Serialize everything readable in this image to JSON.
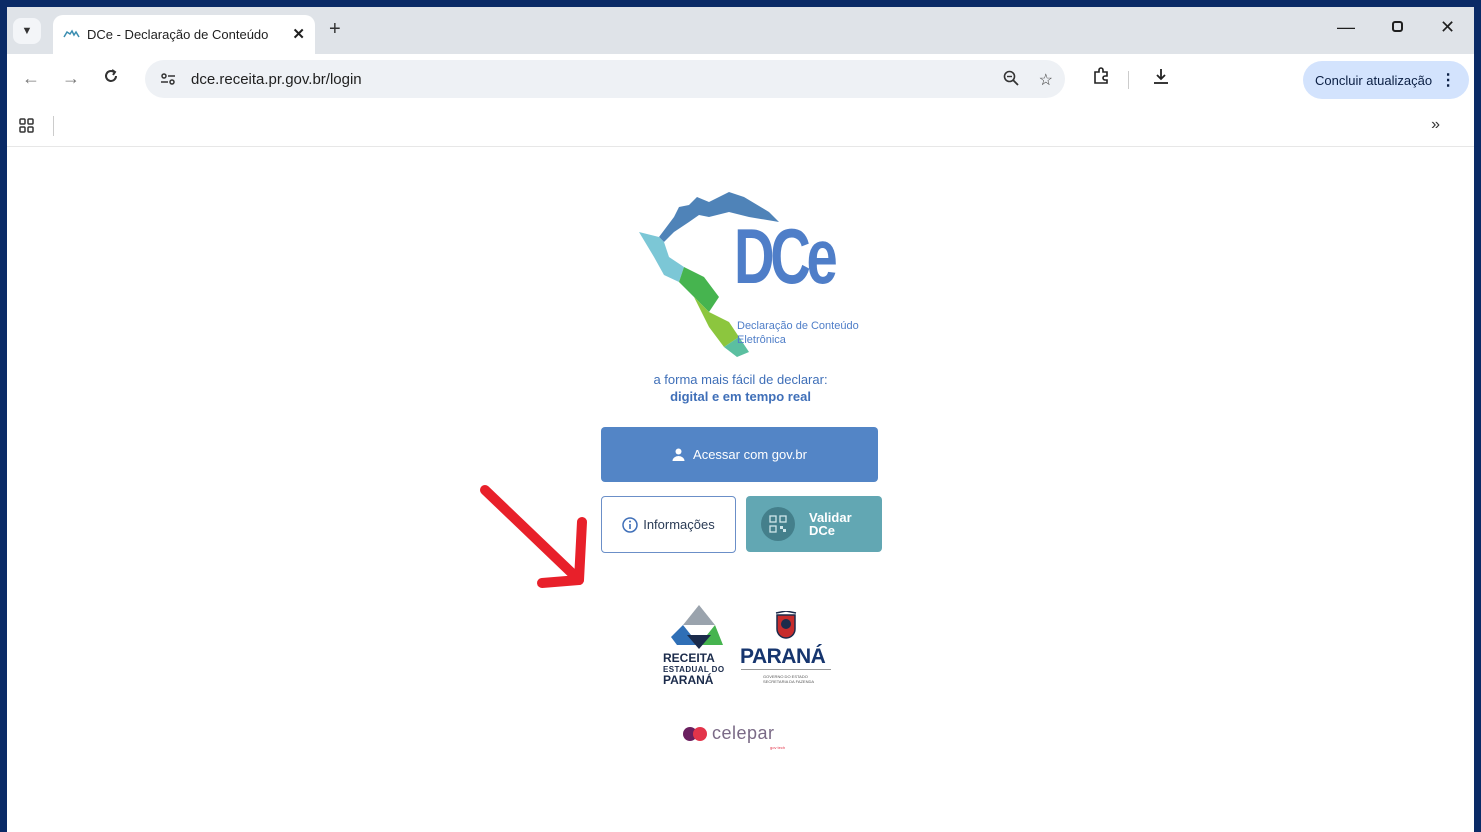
{
  "browser": {
    "tab": {
      "title": "DCe - Declaração de Conteúdo"
    },
    "url": "dce.receita.pr.gov.br/login",
    "update_button": "Concluir atualização"
  },
  "page": {
    "logo": {
      "name": "DCe",
      "subtitle_line1": "Declaração de Conteúdo",
      "subtitle_line2": "Eletrônica"
    },
    "tagline_line1": "a forma mais fácil de declarar:",
    "tagline_line2": "digital e em tempo real",
    "login_button": "Acessar com gov.br",
    "info_button": "Informações",
    "validar_line1": "Validar",
    "validar_line2": "DCe",
    "footer": {
      "receita_line1": "RECEITA",
      "receita_line2": "ESTADUAL DO",
      "receita_line3": "PARANÁ",
      "parana": "PARANÁ",
      "parana_sub1": "GOVERNO DO ESTADO",
      "parana_sub2": "SECRETARIA DA FAZENDA",
      "celepar": "celepar",
      "celepar_tag": "gov tech"
    }
  },
  "colors": {
    "frame": "#0a2a66",
    "primary_button": "#5385c6",
    "validar_button": "#62a7b3",
    "annotation_arrow": "#e8202a"
  },
  "icons": [
    "tab-list-icon",
    "favicon-icon",
    "close-icon",
    "new-tab-icon",
    "minimize-icon",
    "restore-icon",
    "window-close-icon",
    "back-icon",
    "forward-icon",
    "reload-icon",
    "site-info-icon",
    "zoom-icon",
    "star-icon",
    "extensions-icon",
    "download-icon",
    "more-icon",
    "apps-icon",
    "chevrons-icon",
    "user-icon",
    "info-icon",
    "qr-icon",
    "arrow-icon"
  ]
}
